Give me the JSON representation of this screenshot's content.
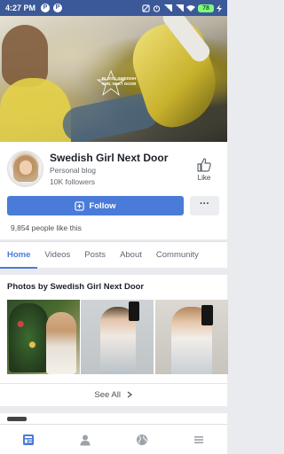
{
  "status_bar": {
    "time": "4:27 PM",
    "badges": [
      "P",
      "P"
    ],
    "battery": "78"
  },
  "cover": {
    "logo_text": "BLOGG SWEDISH GIRL NEXT DOOR"
  },
  "profile": {
    "name": "Swedish Girl Next Door",
    "category": "Personal blog",
    "followers": "10K followers",
    "like_label": "Like",
    "follow_label": "Follow",
    "more_label": "···",
    "likes_count": "9,854 people like this"
  },
  "tabs": [
    {
      "label": "Home",
      "active": true
    },
    {
      "label": "Videos",
      "active": false
    },
    {
      "label": "Posts",
      "active": false
    },
    {
      "label": "About",
      "active": false
    },
    {
      "label": "Community",
      "active": false
    }
  ],
  "photos": {
    "title": "Photos by Swedish Girl Next Door",
    "see_all": "See All"
  },
  "bottom_nav": [
    "feed-icon",
    "profile-icon",
    "globe-icon",
    "menu-icon"
  ],
  "colors": {
    "brand": "#3b5998",
    "accent": "#4a7bd9"
  }
}
